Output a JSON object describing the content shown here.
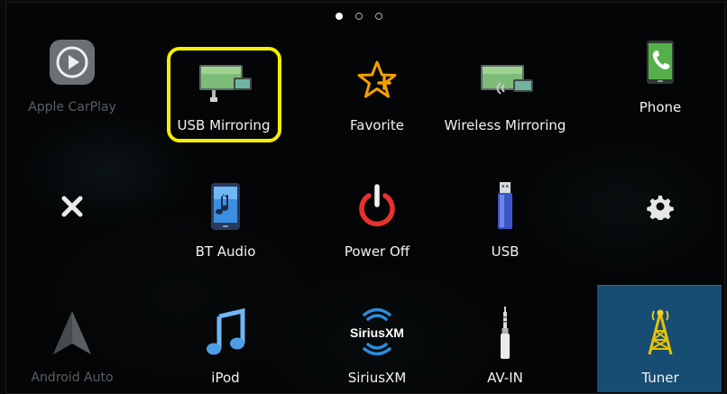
{
  "page_indicator": {
    "pages": 3,
    "current": 1
  },
  "colors": {
    "highlight": "#f4ef00",
    "selected_tile_bg": "#174d73"
  },
  "left_column": {
    "carplay": {
      "label": "Apple CarPlay",
      "icon": "carplay-icon"
    },
    "close": {
      "icon": "close-icon"
    },
    "android_auto": {
      "label": "Android Auto",
      "icon": "android-auto-icon"
    }
  },
  "right_column": {
    "phone": {
      "label": "Phone",
      "icon": "phone-icon"
    },
    "settings": {
      "icon": "gear-icon"
    },
    "tuner": {
      "label": "Tuner",
      "icon": "tuner-icon",
      "selected": true
    }
  },
  "grid": {
    "usb_mirroring": {
      "label": "USB Mirroring",
      "icon": "usb-mirroring-icon",
      "highlighted": true
    },
    "favorite": {
      "label": "Favorite",
      "icon": "favorite-star-icon"
    },
    "wireless_mirroring": {
      "label": "Wireless Mirroring",
      "icon": "wireless-mirroring-icon"
    },
    "bt_audio": {
      "label": "BT Audio",
      "icon": "bt-audio-icon"
    },
    "power_off": {
      "label": "Power Off",
      "icon": "power-icon"
    },
    "usb": {
      "label": "USB",
      "icon": "usb-drive-icon"
    },
    "ipod": {
      "label": "iPod",
      "icon": "music-note-icon"
    },
    "siriusxm": {
      "label": "SiriusXM",
      "logo_text": "SiriusXM",
      "icon": "siriusxm-icon"
    },
    "av_in": {
      "label": "AV-IN",
      "icon": "av-in-plug-icon"
    }
  }
}
